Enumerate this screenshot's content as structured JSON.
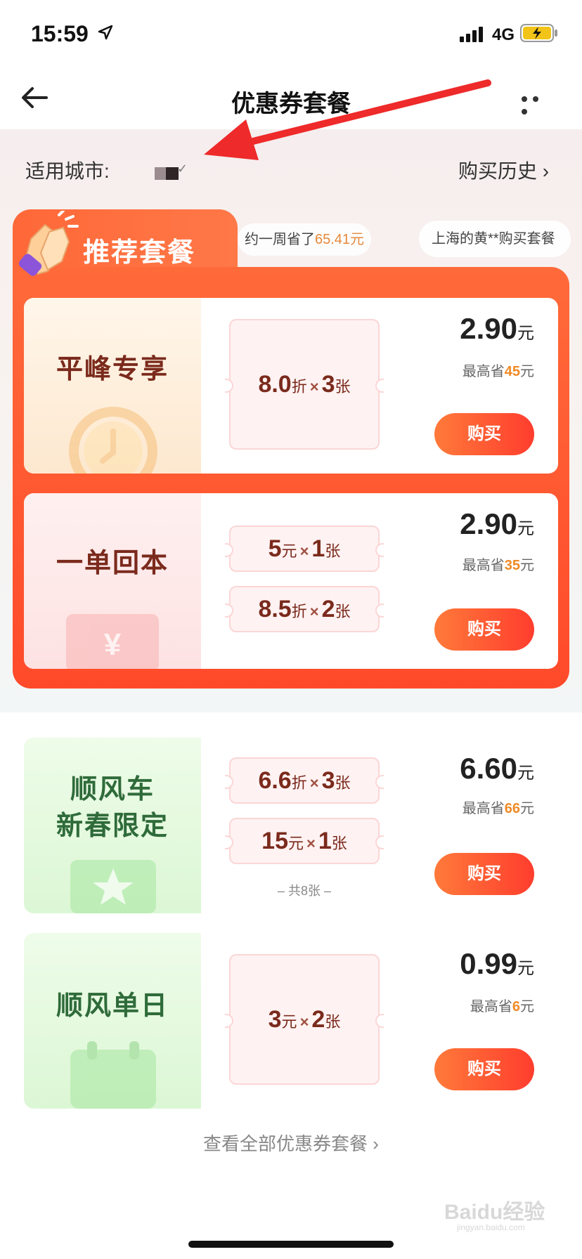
{
  "status": {
    "time": "15:59",
    "network": "4G"
  },
  "nav": {
    "title": "优惠券套餐"
  },
  "city": {
    "label": "适用城市:"
  },
  "history": {
    "label": "购买历史 ›"
  },
  "ticker": {
    "msg1_prefix": "约一周省了",
    "msg1_amount": "65.41元",
    "msg2": "上海的黄**购买套餐"
  },
  "recommended": {
    "title": "推荐套餐"
  },
  "packages": [
    {
      "name_line1": "平峰专享",
      "coupons": [
        {
          "value": "8.0",
          "unit": "折",
          "count": "3",
          "count_unit": "张"
        }
      ],
      "price": "2.90",
      "price_unit": "元",
      "save_prefix": "最高省",
      "save_amount": "45",
      "save_unit": "元",
      "buy": "购买"
    },
    {
      "name_line1": "一单回本",
      "coupons": [
        {
          "value": "5",
          "unit": "元",
          "count": "1",
          "count_unit": "张"
        },
        {
          "value": "8.5",
          "unit": "折",
          "count": "2",
          "count_unit": "张"
        }
      ],
      "price": "2.90",
      "price_unit": "元",
      "save_prefix": "最高省",
      "save_amount": "35",
      "save_unit": "元",
      "buy": "购买"
    },
    {
      "name_line1": "顺风车",
      "name_line2": "新春限定",
      "coupons": [
        {
          "value": "6.6",
          "unit": "折",
          "count": "3",
          "count_unit": "张"
        },
        {
          "value": "15",
          "unit": "元",
          "count": "1",
          "count_unit": "张"
        }
      ],
      "total_note": "– 共8张 –",
      "price": "6.60",
      "price_unit": "元",
      "save_prefix": "最高省",
      "save_amount": "66",
      "save_unit": "元",
      "buy": "购买"
    },
    {
      "name_line1": "顺风单日",
      "coupons": [
        {
          "value": "3",
          "unit": "元",
          "count": "2",
          "count_unit": "张"
        }
      ],
      "price": "0.99",
      "price_unit": "元",
      "save_prefix": "最高省",
      "save_amount": "6",
      "save_unit": "元",
      "buy": "购买"
    }
  ],
  "view_all": {
    "label": "查看全部优惠券套餐 ›"
  },
  "watermark": {
    "text": "Baidu经验",
    "sub": "jingyan.baidu.com"
  },
  "colors": {
    "accent": "#ff4a2a",
    "button": "#ff3d2e",
    "highlight": "#f08a26",
    "coupon_text": "#7a2a1c",
    "green_text": "#2f6b3a"
  }
}
